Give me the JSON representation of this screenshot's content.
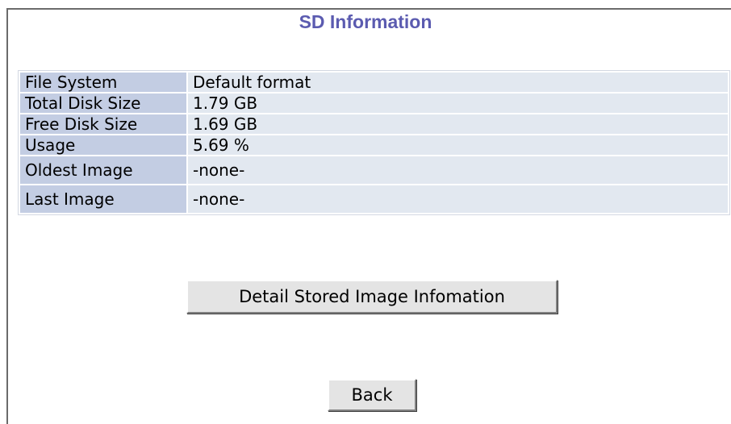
{
  "page": {
    "title": "SD Information"
  },
  "sd_info": {
    "rows": [
      {
        "label": "File System",
        "value": "Default format"
      },
      {
        "label": "Total Disk Size",
        "value": "1.79 GB"
      },
      {
        "label": "Free Disk Size",
        "value": "1.69 GB"
      },
      {
        "label": "Usage",
        "value": "5.69 %"
      },
      {
        "label": "Oldest Image",
        "value": "-none-"
      },
      {
        "label": "Last Image",
        "value": "-none-"
      }
    ]
  },
  "buttons": {
    "detail_label": "Detail Stored Image Infomation",
    "back_label": "Back"
  },
  "colors": {
    "title": "#5b5bb0",
    "label_cell": "#c3cde3",
    "value_cell": "#e2e8f0"
  }
}
